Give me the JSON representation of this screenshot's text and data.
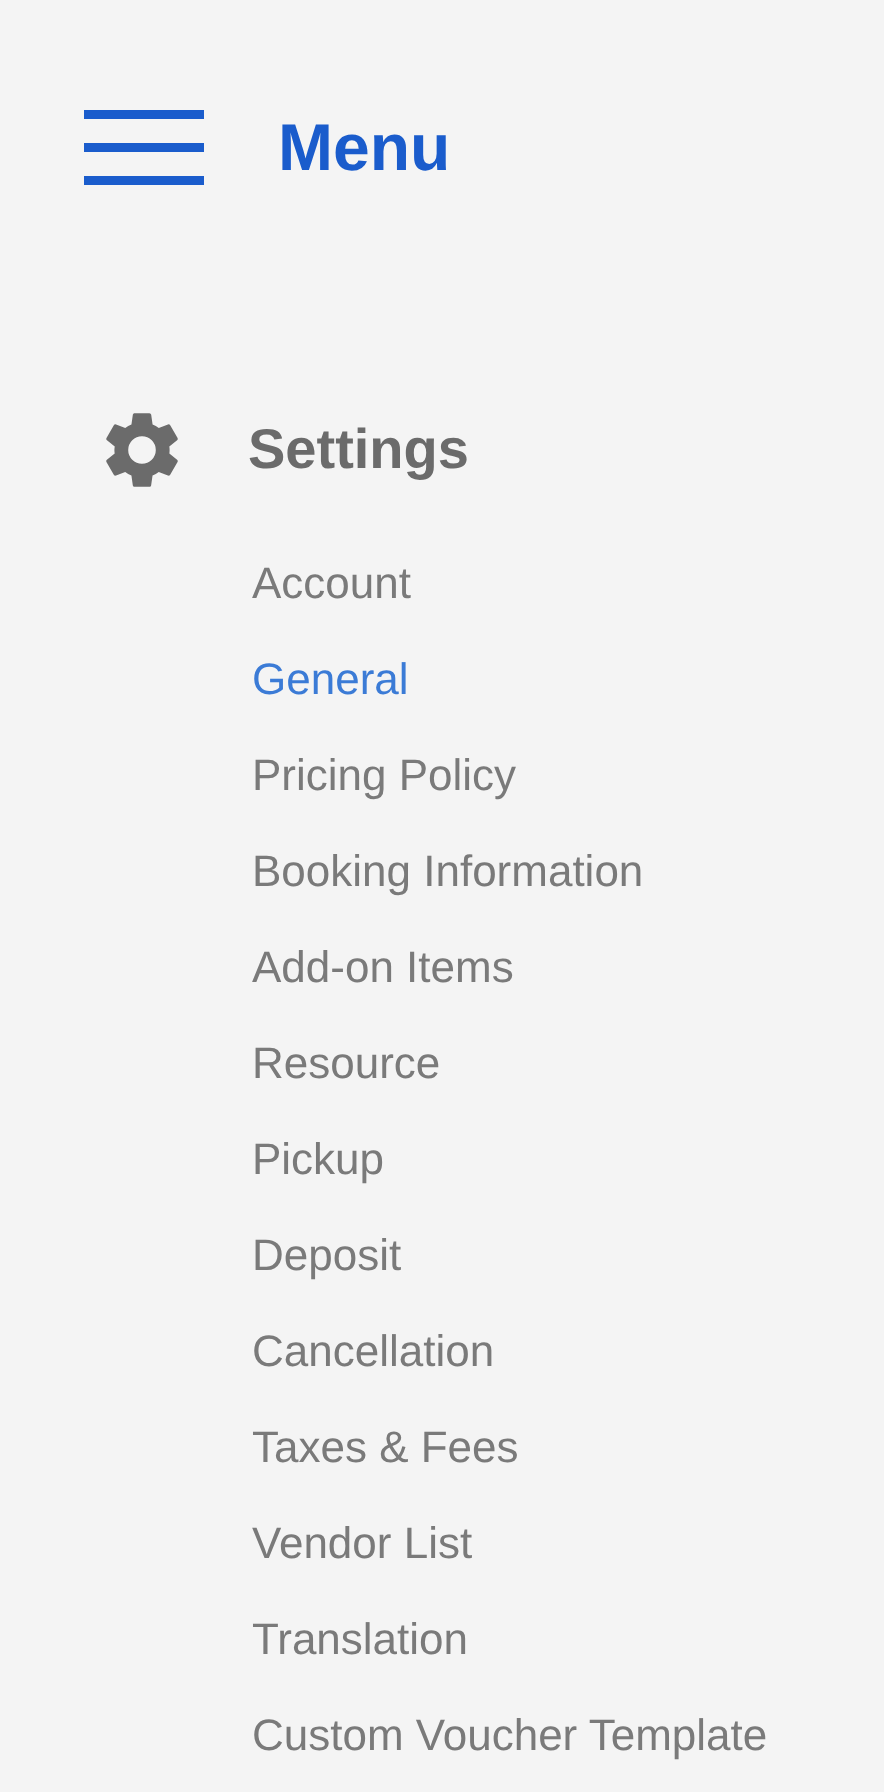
{
  "header": {
    "title": "Menu"
  },
  "section": {
    "title": "Settings",
    "items": [
      {
        "label": "Account",
        "selected": false
      },
      {
        "label": "General",
        "selected": true
      },
      {
        "label": "Pricing Policy",
        "selected": false
      },
      {
        "label": "Booking Information",
        "selected": false
      },
      {
        "label": "Add-on Items",
        "selected": false
      },
      {
        "label": "Resource",
        "selected": false
      },
      {
        "label": "Pickup",
        "selected": false
      },
      {
        "label": "Deposit",
        "selected": false
      },
      {
        "label": "Cancellation",
        "selected": false
      },
      {
        "label": "Taxes & Fees",
        "selected": false
      },
      {
        "label": "Vendor List",
        "selected": false
      },
      {
        "label": "Translation",
        "selected": false
      },
      {
        "label": "Custom Voucher Template",
        "selected": false
      }
    ]
  }
}
